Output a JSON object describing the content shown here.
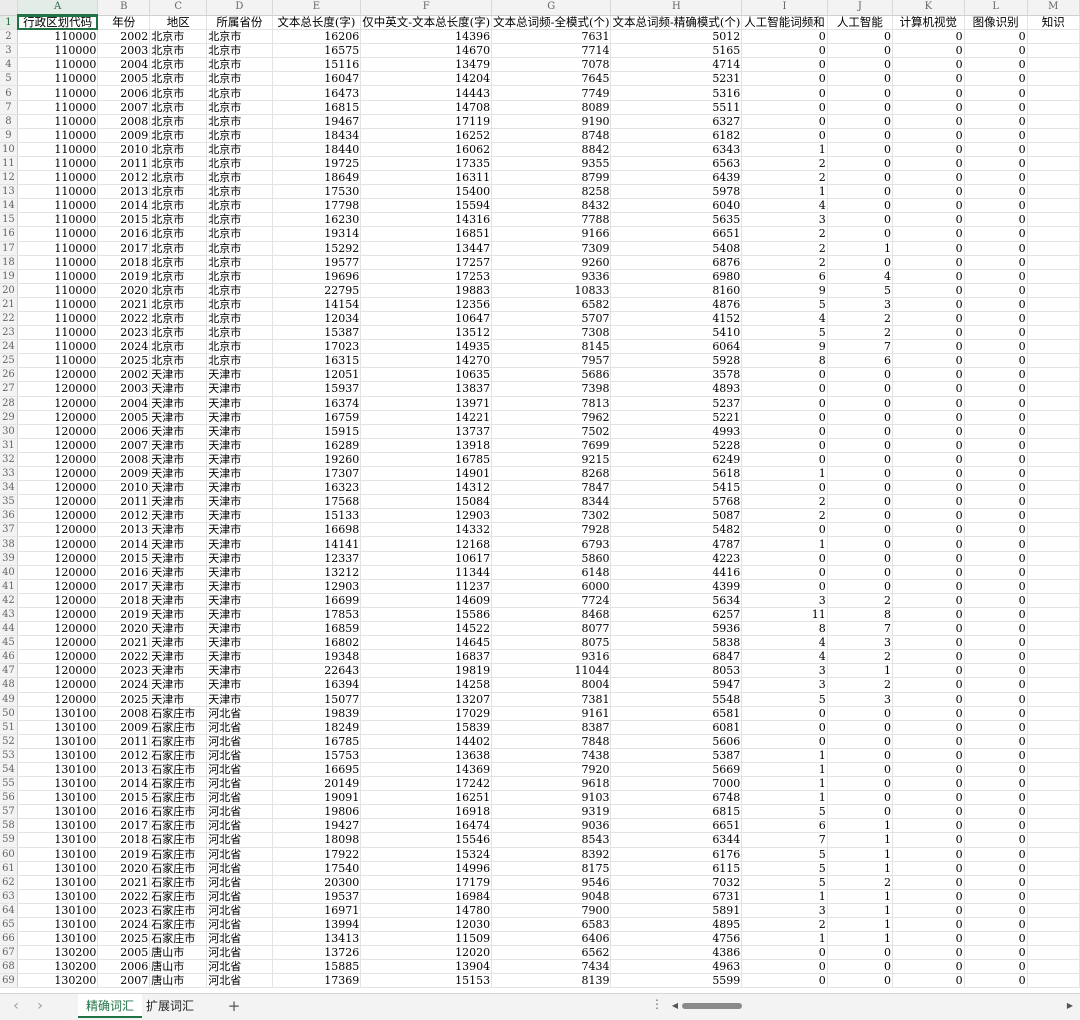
{
  "sheet": {
    "column_letters": [
      "A",
      "B",
      "C",
      "D",
      "E",
      "F",
      "G",
      "H",
      "I",
      "J",
      "K",
      "L",
      "M"
    ],
    "headers": [
      "行政区划代码",
      "年份",
      "地区",
      "所属省份",
      "文本总长度(字)",
      "仅中英文-文本总长度(字)",
      "文本总词频-全模式(个)",
      "文本总词频-精确模式(个)",
      "人工智能词频和",
      "人工智能",
      "计算机视觉",
      "图像识别",
      "知识"
    ],
    "rows": [
      [
        "110000",
        "2002",
        "北京市",
        "北京市",
        "16206",
        "14396",
        "7631",
        "5012",
        "0",
        "0",
        "0",
        "0"
      ],
      [
        "110000",
        "2003",
        "北京市",
        "北京市",
        "16575",
        "14670",
        "7714",
        "5165",
        "0",
        "0",
        "0",
        "0"
      ],
      [
        "110000",
        "2004",
        "北京市",
        "北京市",
        "15116",
        "13479",
        "7078",
        "4714",
        "0",
        "0",
        "0",
        "0"
      ],
      [
        "110000",
        "2005",
        "北京市",
        "北京市",
        "16047",
        "14204",
        "7645",
        "5231",
        "0",
        "0",
        "0",
        "0"
      ],
      [
        "110000",
        "2006",
        "北京市",
        "北京市",
        "16473",
        "14443",
        "7749",
        "5316",
        "0",
        "0",
        "0",
        "0"
      ],
      [
        "110000",
        "2007",
        "北京市",
        "北京市",
        "16815",
        "14708",
        "8089",
        "5511",
        "0",
        "0",
        "0",
        "0"
      ],
      [
        "110000",
        "2008",
        "北京市",
        "北京市",
        "19467",
        "17119",
        "9190",
        "6327",
        "0",
        "0",
        "0",
        "0"
      ],
      [
        "110000",
        "2009",
        "北京市",
        "北京市",
        "18434",
        "16252",
        "8748",
        "6182",
        "0",
        "0",
        "0",
        "0"
      ],
      [
        "110000",
        "2010",
        "北京市",
        "北京市",
        "18440",
        "16062",
        "8842",
        "6343",
        "1",
        "0",
        "0",
        "0"
      ],
      [
        "110000",
        "2011",
        "北京市",
        "北京市",
        "19725",
        "17335",
        "9355",
        "6563",
        "2",
        "0",
        "0",
        "0"
      ],
      [
        "110000",
        "2012",
        "北京市",
        "北京市",
        "18649",
        "16311",
        "8799",
        "6439",
        "2",
        "0",
        "0",
        "0"
      ],
      [
        "110000",
        "2013",
        "北京市",
        "北京市",
        "17530",
        "15400",
        "8258",
        "5978",
        "1",
        "0",
        "0",
        "0"
      ],
      [
        "110000",
        "2014",
        "北京市",
        "北京市",
        "17798",
        "15594",
        "8432",
        "6040",
        "4",
        "0",
        "0",
        "0"
      ],
      [
        "110000",
        "2015",
        "北京市",
        "北京市",
        "16230",
        "14316",
        "7788",
        "5635",
        "3",
        "0",
        "0",
        "0"
      ],
      [
        "110000",
        "2016",
        "北京市",
        "北京市",
        "19314",
        "16851",
        "9166",
        "6651",
        "2",
        "0",
        "0",
        "0"
      ],
      [
        "110000",
        "2017",
        "北京市",
        "北京市",
        "15292",
        "13447",
        "7309",
        "5408",
        "2",
        "1",
        "0",
        "0"
      ],
      [
        "110000",
        "2018",
        "北京市",
        "北京市",
        "19577",
        "17257",
        "9260",
        "6876",
        "2",
        "0",
        "0",
        "0"
      ],
      [
        "110000",
        "2019",
        "北京市",
        "北京市",
        "19696",
        "17253",
        "9336",
        "6980",
        "6",
        "4",
        "0",
        "0"
      ],
      [
        "110000",
        "2020",
        "北京市",
        "北京市",
        "22795",
        "19883",
        "10833",
        "8160",
        "9",
        "5",
        "0",
        "0"
      ],
      [
        "110000",
        "2021",
        "北京市",
        "北京市",
        "14154",
        "12356",
        "6582",
        "4876",
        "5",
        "3",
        "0",
        "0"
      ],
      [
        "110000",
        "2022",
        "北京市",
        "北京市",
        "12034",
        "10647",
        "5707",
        "4152",
        "4",
        "2",
        "0",
        "0"
      ],
      [
        "110000",
        "2023",
        "北京市",
        "北京市",
        "15387",
        "13512",
        "7308",
        "5410",
        "5",
        "2",
        "0",
        "0"
      ],
      [
        "110000",
        "2024",
        "北京市",
        "北京市",
        "17023",
        "14935",
        "8145",
        "6064",
        "9",
        "7",
        "0",
        "0"
      ],
      [
        "110000",
        "2025",
        "北京市",
        "北京市",
        "16315",
        "14270",
        "7957",
        "5928",
        "8",
        "6",
        "0",
        "0"
      ],
      [
        "120000",
        "2002",
        "天津市",
        "天津市",
        "12051",
        "10635",
        "5686",
        "3578",
        "0",
        "0",
        "0",
        "0"
      ],
      [
        "120000",
        "2003",
        "天津市",
        "天津市",
        "15937",
        "13837",
        "7398",
        "4893",
        "0",
        "0",
        "0",
        "0"
      ],
      [
        "120000",
        "2004",
        "天津市",
        "天津市",
        "16374",
        "13971",
        "7813",
        "5237",
        "0",
        "0",
        "0",
        "0"
      ],
      [
        "120000",
        "2005",
        "天津市",
        "天津市",
        "16759",
        "14221",
        "7962",
        "5221",
        "0",
        "0",
        "0",
        "0"
      ],
      [
        "120000",
        "2006",
        "天津市",
        "天津市",
        "15915",
        "13737",
        "7502",
        "4993",
        "0",
        "0",
        "0",
        "0"
      ],
      [
        "120000",
        "2007",
        "天津市",
        "天津市",
        "16289",
        "13918",
        "7699",
        "5228",
        "0",
        "0",
        "0",
        "0"
      ],
      [
        "120000",
        "2008",
        "天津市",
        "天津市",
        "19260",
        "16785",
        "9215",
        "6249",
        "0",
        "0",
        "0",
        "0"
      ],
      [
        "120000",
        "2009",
        "天津市",
        "天津市",
        "17307",
        "14901",
        "8268",
        "5618",
        "1",
        "0",
        "0",
        "0"
      ],
      [
        "120000",
        "2010",
        "天津市",
        "天津市",
        "16323",
        "14312",
        "7847",
        "5415",
        "0",
        "0",
        "0",
        "0"
      ],
      [
        "120000",
        "2011",
        "天津市",
        "天津市",
        "17568",
        "15084",
        "8344",
        "5768",
        "2",
        "0",
        "0",
        "0"
      ],
      [
        "120000",
        "2012",
        "天津市",
        "天津市",
        "15133",
        "12903",
        "7302",
        "5087",
        "2",
        "0",
        "0",
        "0"
      ],
      [
        "120000",
        "2013",
        "天津市",
        "天津市",
        "16698",
        "14332",
        "7928",
        "5482",
        "0",
        "0",
        "0",
        "0"
      ],
      [
        "120000",
        "2014",
        "天津市",
        "天津市",
        "14141",
        "12168",
        "6793",
        "4787",
        "1",
        "0",
        "0",
        "0"
      ],
      [
        "120000",
        "2015",
        "天津市",
        "天津市",
        "12337",
        "10617",
        "5860",
        "4223",
        "0",
        "0",
        "0",
        "0"
      ],
      [
        "120000",
        "2016",
        "天津市",
        "天津市",
        "13212",
        "11344",
        "6148",
        "4416",
        "0",
        "0",
        "0",
        "0"
      ],
      [
        "120000",
        "2017",
        "天津市",
        "天津市",
        "12903",
        "11237",
        "6000",
        "4399",
        "0",
        "0",
        "0",
        "0"
      ],
      [
        "120000",
        "2018",
        "天津市",
        "天津市",
        "16699",
        "14609",
        "7724",
        "5634",
        "3",
        "2",
        "0",
        "0"
      ],
      [
        "120000",
        "2019",
        "天津市",
        "天津市",
        "17853",
        "15586",
        "8468",
        "6257",
        "11",
        "8",
        "0",
        "0"
      ],
      [
        "120000",
        "2020",
        "天津市",
        "天津市",
        "16859",
        "14522",
        "8077",
        "5936",
        "8",
        "7",
        "0",
        "0"
      ],
      [
        "120000",
        "2021",
        "天津市",
        "天津市",
        "16802",
        "14645",
        "8075",
        "5838",
        "4",
        "3",
        "0",
        "0"
      ],
      [
        "120000",
        "2022",
        "天津市",
        "天津市",
        "19348",
        "16837",
        "9316",
        "6847",
        "4",
        "2",
        "0",
        "0"
      ],
      [
        "120000",
        "2023",
        "天津市",
        "天津市",
        "22643",
        "19819",
        "11044",
        "8053",
        "3",
        "1",
        "0",
        "0"
      ],
      [
        "120000",
        "2024",
        "天津市",
        "天津市",
        "16394",
        "14258",
        "8004",
        "5947",
        "3",
        "2",
        "0",
        "0"
      ],
      [
        "120000",
        "2025",
        "天津市",
        "天津市",
        "15077",
        "13207",
        "7381",
        "5548",
        "5",
        "3",
        "0",
        "0"
      ],
      [
        "130100",
        "2008",
        "石家庄市",
        "河北省",
        "19839",
        "17029",
        "9161",
        "6581",
        "0",
        "0",
        "0",
        "0"
      ],
      [
        "130100",
        "2009",
        "石家庄市",
        "河北省",
        "18249",
        "15839",
        "8387",
        "6081",
        "0",
        "0",
        "0",
        "0"
      ],
      [
        "130100",
        "2011",
        "石家庄市",
        "河北省",
        "16785",
        "14402",
        "7848",
        "5606",
        "0",
        "0",
        "0",
        "0"
      ],
      [
        "130100",
        "2012",
        "石家庄市",
        "河北省",
        "15753",
        "13638",
        "7438",
        "5387",
        "1",
        "0",
        "0",
        "0"
      ],
      [
        "130100",
        "2013",
        "石家庄市",
        "河北省",
        "16695",
        "14369",
        "7920",
        "5669",
        "1",
        "0",
        "0",
        "0"
      ],
      [
        "130100",
        "2014",
        "石家庄市",
        "河北省",
        "20149",
        "17242",
        "9618",
        "7000",
        "1",
        "0",
        "0",
        "0"
      ],
      [
        "130100",
        "2015",
        "石家庄市",
        "河北省",
        "19091",
        "16251",
        "9103",
        "6748",
        "1",
        "0",
        "0",
        "0"
      ],
      [
        "130100",
        "2016",
        "石家庄市",
        "河北省",
        "19806",
        "16918",
        "9319",
        "6815",
        "5",
        "0",
        "0",
        "0"
      ],
      [
        "130100",
        "2017",
        "石家庄市",
        "河北省",
        "19427",
        "16474",
        "9036",
        "6651",
        "6",
        "1",
        "0",
        "0"
      ],
      [
        "130100",
        "2018",
        "石家庄市",
        "河北省",
        "18098",
        "15546",
        "8543",
        "6344",
        "7",
        "1",
        "0",
        "0"
      ],
      [
        "130100",
        "2019",
        "石家庄市",
        "河北省",
        "17922",
        "15324",
        "8392",
        "6176",
        "5",
        "1",
        "0",
        "0"
      ],
      [
        "130100",
        "2020",
        "石家庄市",
        "河北省",
        "17540",
        "14996",
        "8175",
        "6115",
        "5",
        "1",
        "0",
        "0"
      ],
      [
        "130100",
        "2021",
        "石家庄市",
        "河北省",
        "20300",
        "17179",
        "9546",
        "7032",
        "5",
        "2",
        "0",
        "0"
      ],
      [
        "130100",
        "2022",
        "石家庄市",
        "河北省",
        "19537",
        "16984",
        "9048",
        "6731",
        "1",
        "1",
        "0",
        "0"
      ],
      [
        "130100",
        "2023",
        "石家庄市",
        "河北省",
        "16971",
        "14780",
        "7900",
        "5891",
        "3",
        "1",
        "0",
        "0"
      ],
      [
        "130100",
        "2024",
        "石家庄市",
        "河北省",
        "13994",
        "12030",
        "6583",
        "4895",
        "2",
        "1",
        "0",
        "0"
      ],
      [
        "130100",
        "2025",
        "石家庄市",
        "河北省",
        "13413",
        "11509",
        "6406",
        "4756",
        "1",
        "1",
        "0",
        "0"
      ],
      [
        "130200",
        "2005",
        "唐山市",
        "河北省",
        "13726",
        "12020",
        "6562",
        "4386",
        "0",
        "0",
        "0",
        "0"
      ],
      [
        "130200",
        "2006",
        "唐山市",
        "河北省",
        "15885",
        "13904",
        "7434",
        "4963",
        "0",
        "0",
        "0",
        "0"
      ],
      [
        "130200",
        "2007",
        "唐山市",
        "河北省",
        "17369",
        "15153",
        "8139",
        "5599",
        "0",
        "0",
        "0",
        "0"
      ]
    ]
  },
  "tabs": [
    {
      "label": "精确词汇",
      "active": true
    },
    {
      "label": "扩展词汇",
      "active": false
    }
  ],
  "add_tab_label": "+",
  "colors": {
    "accent": "#217346",
    "header_bg": "#f3f3f3",
    "gridline": "#e3e3e3"
  }
}
